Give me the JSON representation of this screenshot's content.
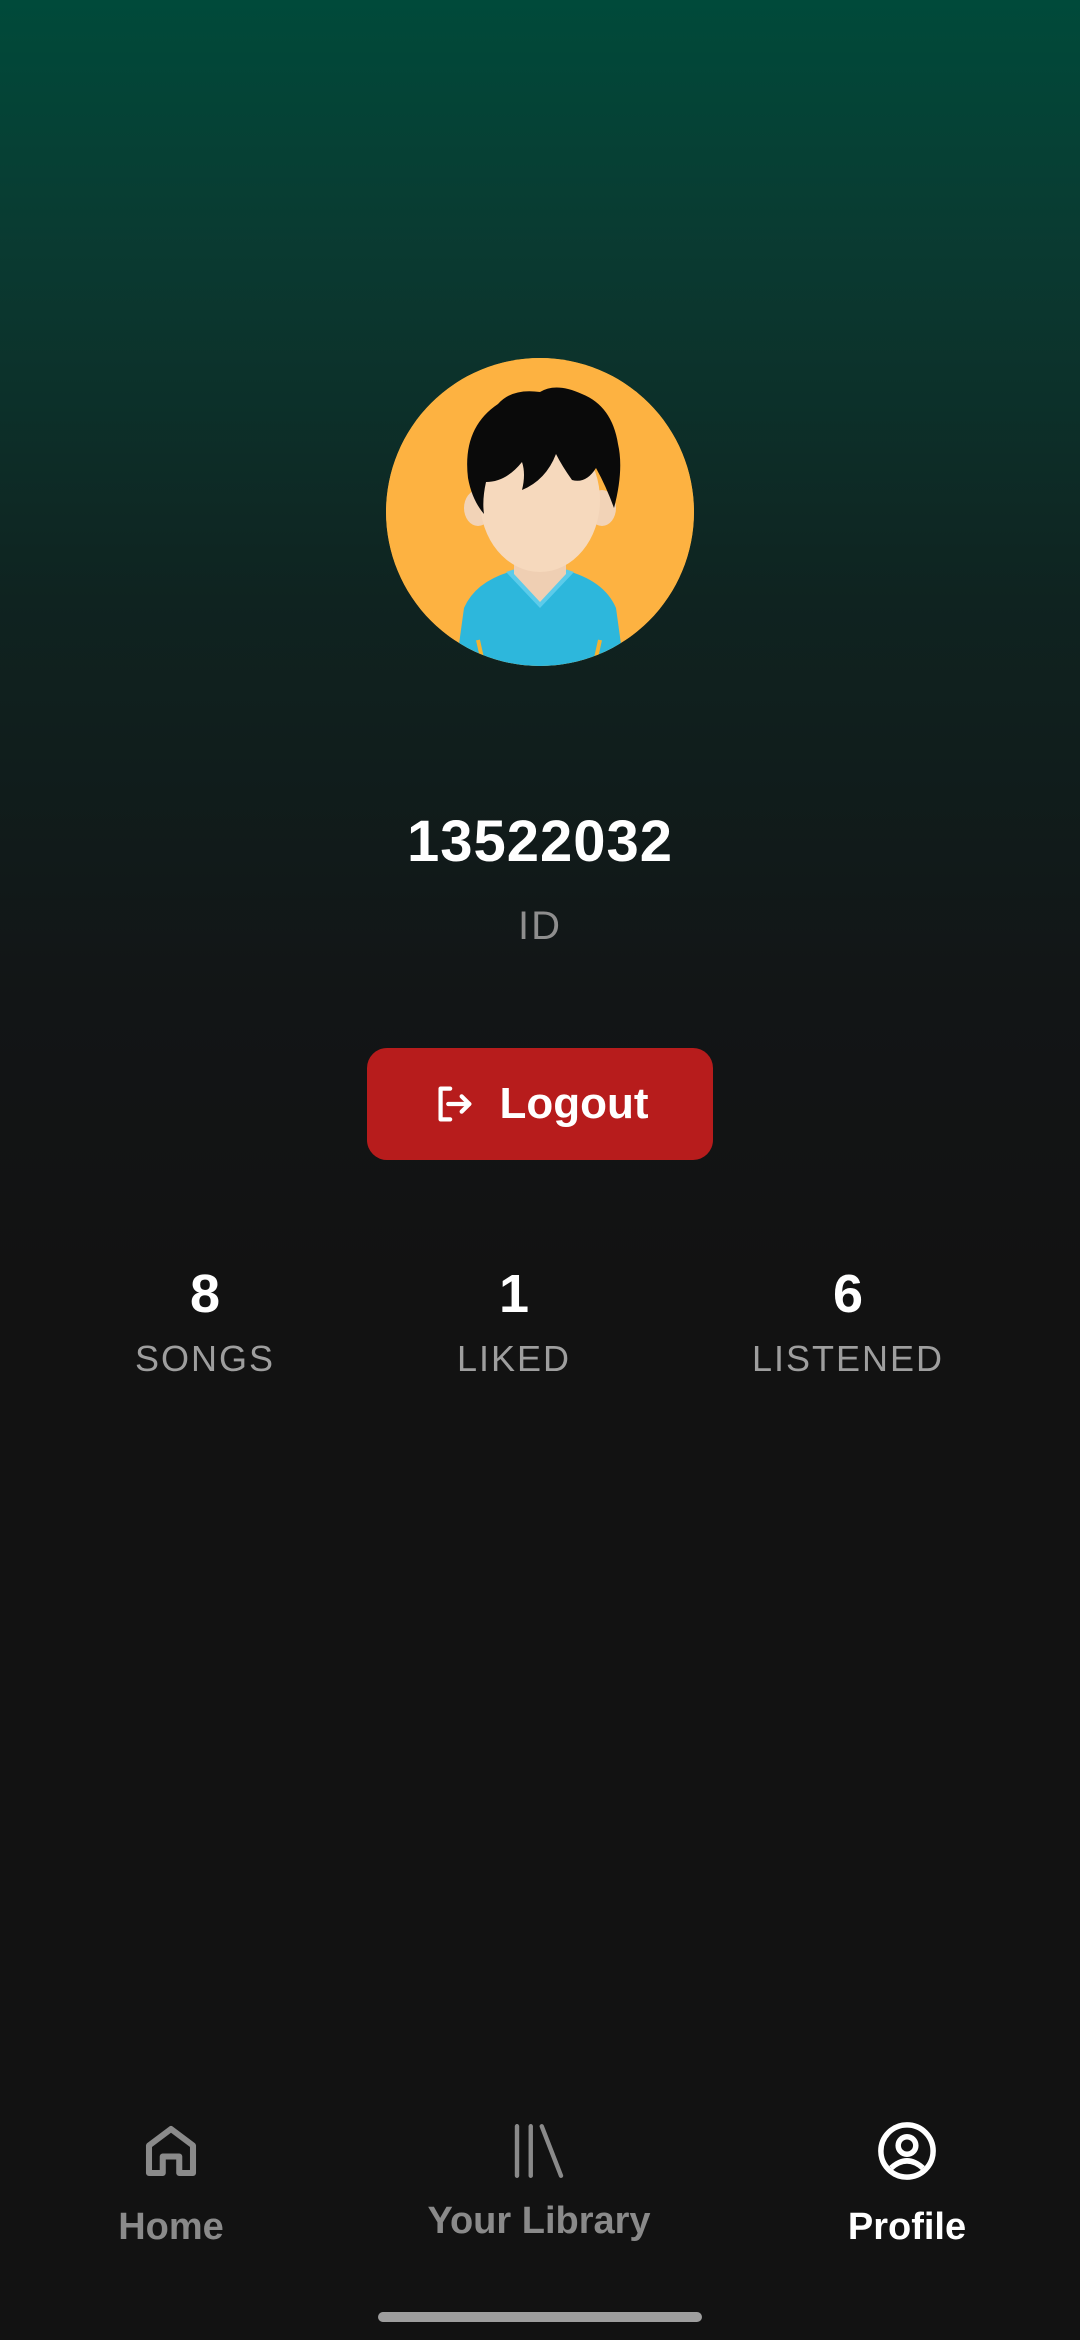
{
  "profile": {
    "user_id": "13522032",
    "id_label": "ID",
    "avatar_icon": "user-avatar-illustration"
  },
  "actions": {
    "logout_label": "Logout",
    "logout_icon": "logout-icon",
    "logout_color": "#B71C1C"
  },
  "stats": [
    {
      "value": "8",
      "label": "SONGS"
    },
    {
      "value": "1",
      "label": "LIKED"
    },
    {
      "value": "6",
      "label": "LISTENED"
    }
  ],
  "bottom_nav": {
    "items": [
      {
        "label": "Home",
        "icon": "home-icon",
        "active": false
      },
      {
        "label": "Your Library",
        "icon": "library-icon",
        "active": false
      },
      {
        "label": "Profile",
        "icon": "profile-icon",
        "active": true
      }
    ]
  },
  "theme": {
    "background": "#121212",
    "gradient_top": "#004a3a",
    "avatar_background": "#FDB241",
    "muted_text": "#8e8e8e"
  }
}
